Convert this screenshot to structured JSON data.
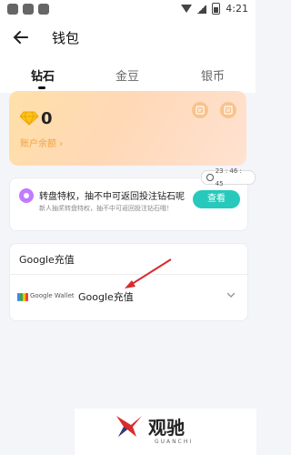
{
  "status_bar": {
    "time": "4:21"
  },
  "header": {
    "title": "钱包"
  },
  "tabs": [
    {
      "label": "钻石",
      "active": true
    },
    {
      "label": "金豆",
      "active": false
    },
    {
      "label": "银币",
      "active": false
    }
  ],
  "balance": {
    "value": "0",
    "label": "账户余额 ›"
  },
  "promo": {
    "title": "转盘特权，抽不中可返回投注钻石呢",
    "subtitle": "新人抽奖转盘特权，抽不中可返回投注钻石哦！",
    "timer": "23 : 46 : 45",
    "button": "查看"
  },
  "google_pay": {
    "header": "Google充值",
    "wallet_label": "Google Wallet",
    "option_title": "Google充值"
  },
  "watermark": {
    "text": "观驰",
    "sub": "GUANCHI"
  },
  "colors": {
    "accent": "#27c9bc",
    "balance_label": "#f0a247",
    "arrow": "#d82c2c"
  }
}
